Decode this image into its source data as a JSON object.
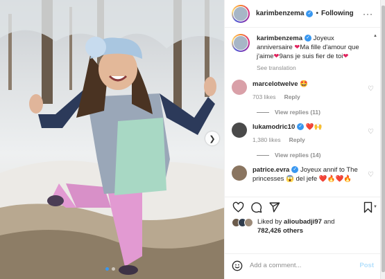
{
  "post": {
    "username": "karimbenzema",
    "follow_status": "Following",
    "separator": "•",
    "more_icon": "more-horizontal-icon",
    "caption_user": "karimbenzema",
    "caption_text_1": "Joyeux anniversaire",
    "caption_text_2": "Ma fille d'amour que j'aime",
    "caption_text_3": "9ans je suis fier de toi",
    "see_translation": "See translation"
  },
  "comments": [
    {
      "user": "marcelotwelve",
      "text": "🤩",
      "likes": "703 likes",
      "reply": "Reply",
      "view_replies": "View replies (11)",
      "avatar_color": "#d9a0a8"
    },
    {
      "user": "lukamodric10",
      "text": "❤️🙌",
      "likes": "1,380 likes",
      "reply": "Reply",
      "view_replies": "View replies (14)",
      "avatar_color": "#4a4a4a"
    },
    {
      "user": "patrice.evra",
      "text": "Joyeux annif to The princesses 😱 del jefe ❤️🔥❤️🔥",
      "avatar_color": "#8a7560"
    }
  ],
  "likes": {
    "liked_by_prefix": "Liked by",
    "liked_by_user": "alioubadji97",
    "and": "and",
    "count": "782,426 others",
    "avatar_colors": [
      "#6b5b4b",
      "#2f3c4d",
      "#9c8a78"
    ]
  },
  "add_comment": {
    "placeholder": "Add a comment...",
    "post_label": "Post"
  },
  "colors": {
    "accent": "#3897f0",
    "heart": "#e0245e",
    "muted": "#8e8e8e"
  }
}
